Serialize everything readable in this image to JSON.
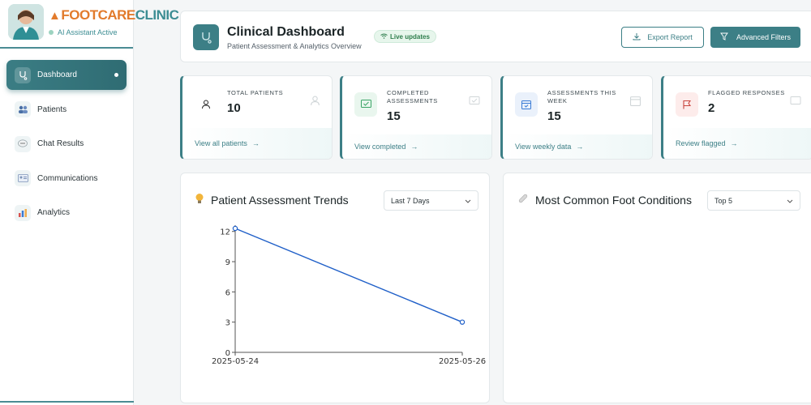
{
  "brand": {
    "logo_foot": "FOOT",
    "logo_care": "CARE",
    "logo_clinic": "CLINIC",
    "status": "AI Assistant Active"
  },
  "sidebar": {
    "items": [
      {
        "label": "Dashboard",
        "icon": "stethoscope-icon",
        "active": true
      },
      {
        "label": "Patients",
        "icon": "users-icon",
        "active": false
      },
      {
        "label": "Chat Results",
        "icon": "chat-bubble-icon",
        "active": false
      },
      {
        "label": "Communications",
        "icon": "id-card-icon",
        "active": false
      },
      {
        "label": "Analytics",
        "icon": "bar-chart-icon",
        "active": false
      }
    ]
  },
  "header": {
    "title": "Clinical Dashboard",
    "subtitle": "Patient Assessment & Analytics Overview",
    "live_badge": "Live updates",
    "export_label": "Export Report",
    "filters_label": "Advanced Filters"
  },
  "stats": [
    {
      "label": "TOTAL PATIENTS",
      "value": "10",
      "link": "View all patients"
    },
    {
      "label": "COMPLETED ASSESSMENTS",
      "value": "15",
      "link": "View completed"
    },
    {
      "label": "ASSESSMENTS THIS WEEK",
      "value": "15",
      "link": "View weekly data"
    },
    {
      "label": "FLAGGED RESPONSES",
      "value": "2",
      "link": "Review flagged"
    }
  ],
  "trends_panel": {
    "title": "Patient Assessment Trends",
    "range_selected": "Last 7 Days"
  },
  "conditions_panel": {
    "title": "Most Common Foot Conditions",
    "top_selected": "Top 5"
  },
  "chart_data": {
    "type": "line",
    "x": [
      "2025-05-24",
      "2025-05-26"
    ],
    "series": [
      {
        "values": [
          12.3,
          3
        ]
      }
    ],
    "yticks": [
      "0",
      "3",
      "6",
      "9",
      "12"
    ],
    "ylim": [
      0,
      12.3
    ],
    "color": "#1f5fc8",
    "grid": false
  },
  "colors": {
    "accent": "#3c7f86",
    "brand_orange": "#e27b2c"
  }
}
